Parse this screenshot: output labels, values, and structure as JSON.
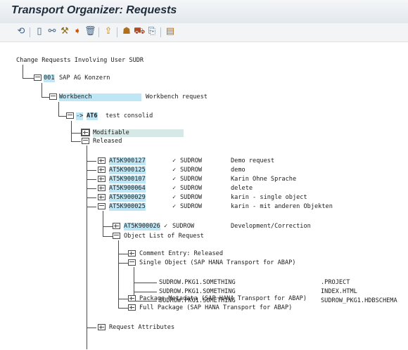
{
  "window": {
    "title": "Transport Organizer: Requests"
  },
  "toolbar": {
    "icons": [
      "refresh-icon",
      "new-document-icon",
      "glasses-icon",
      "tool-icon",
      "transport-icon",
      "trash-icon",
      "upload-icon",
      "people-icon",
      "export-icon",
      "copy-icon",
      "object-icon"
    ]
  },
  "tree": {
    "header": "Change Requests Involving User SUDR",
    "client": {
      "id": "001",
      "name": "SAP AG Konzern"
    },
    "workbench": {
      "label": "Workbench",
      "desc": "Workbench request"
    },
    "target": {
      "prefix": "->",
      "sys": "AT6",
      "desc": "test consolid"
    },
    "modifiable": "Modifiable",
    "released": "Released",
    "requests": [
      {
        "id": "AT5K900127",
        "check": "✓",
        "owner": "SUDROW",
        "desc": "Demo request"
      },
      {
        "id": "AT5K900125",
        "check": "✓",
        "owner": "SUDROW",
        "desc": "demo"
      },
      {
        "id": "AT5K900107",
        "check": "✓",
        "owner": "SUDROW",
        "desc": "Karin Ohne Sprache"
      },
      {
        "id": "AT5K900064",
        "check": "✓",
        "owner": "SUDROW",
        "desc": "delete"
      },
      {
        "id": "AT5K900029",
        "check": "✓",
        "owner": "SUDROW",
        "desc": "karin - single object"
      },
      {
        "id": "AT5K900025",
        "check": "✓",
        "owner": "SUDROW",
        "desc": "karin - mit anderen Objekten"
      }
    ],
    "task": {
      "id": "AT5K900026",
      "check": "✓",
      "owner": "SUDROW",
      "desc": "Development/Correction"
    },
    "object_list": "Object List of Request",
    "comment_entry": "Comment Entry: Released",
    "single_object": "Single Object (SAP HANA Transport for ABAP)",
    "objects": [
      {
        "pkg": "SUDROW.PKG1.SOMETHING",
        "name": ".PROJECT"
      },
      {
        "pkg": "SUDROW.PKG1.SOMETHING",
        "name": "INDEX.HTML"
      },
      {
        "pkg": "SUDROW.PKG1.SOMETHING",
        "name": "SUDROW_PKG1.HDBSCHEMA"
      }
    ],
    "package_metadata": "Package Metadata (SAP HANA Transport for ABAP)",
    "full_package": "Full Package (SAP HANA Transport for ABAP)",
    "request_attributes": "Request Attributes"
  }
}
